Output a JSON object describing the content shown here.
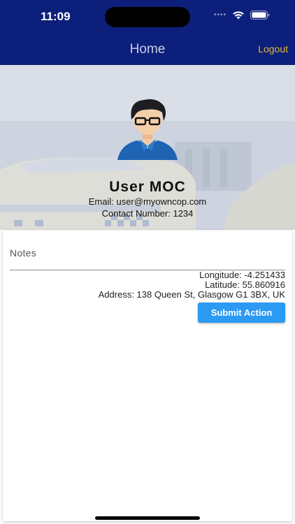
{
  "status_bar": {
    "time": "11:09"
  },
  "header": {
    "title": "Home",
    "logout_label": "Logout"
  },
  "profile": {
    "name": "User  MOC",
    "email": "Email: user@myowncop.com",
    "contact": "Contact Number: 1234"
  },
  "form": {
    "notes_label": "Notes",
    "notes_value": "",
    "longitude": "Longitude: -4.251433",
    "latitude": "Latitude: 55.860916",
    "address": "Address: 138 Queen St, Glasgow G1 3BX, UK",
    "submit_label": "Submit Action"
  },
  "colors": {
    "appbar": "#0c1f7a",
    "logout": "#e2b93b",
    "submit_button": "#2b9af3"
  },
  "icons": [
    "wifi-icon",
    "battery-icon",
    "avatar-icon"
  ]
}
